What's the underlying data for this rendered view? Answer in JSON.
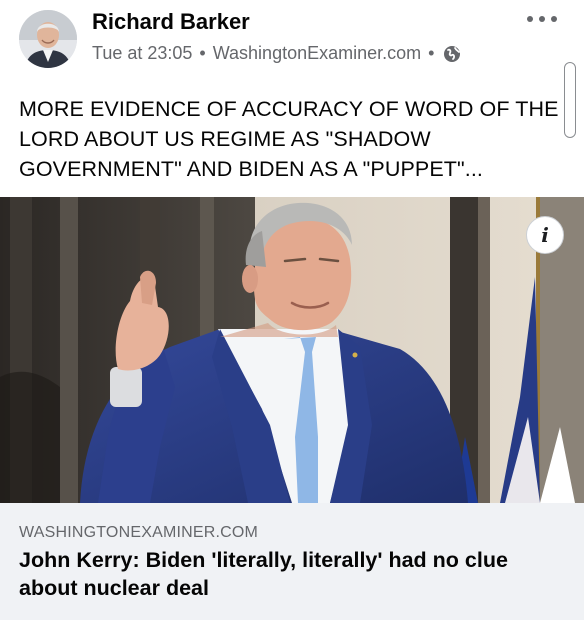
{
  "post": {
    "author": "Richard Barker",
    "timestamp": "Tue at 23:05",
    "separator": "•",
    "source": "WashingtonExaminer.com",
    "audience_icon": "globe-icon",
    "menu_icon": "more-options-icon",
    "text": "MORE EVIDENCE OF ACCURACY OF WORD OF THE LORD ABOUT US REGIME AS \"SHADOW GOVERNMENT\" AND BIDEN AS A \"PUPPET\"..."
  },
  "link_preview": {
    "domain": "WASHINGTONEXAMINER.COM",
    "headline": "John Kerry: Biden 'literally, literally' had no clue about nuclear deal",
    "info_label": "i"
  },
  "colors": {
    "text_primary": "#050505",
    "text_secondary": "#65676b",
    "card_background": "#f0f2f5",
    "suit_blue": "#2a3f86",
    "tie_blue": "#8fb7e6"
  }
}
